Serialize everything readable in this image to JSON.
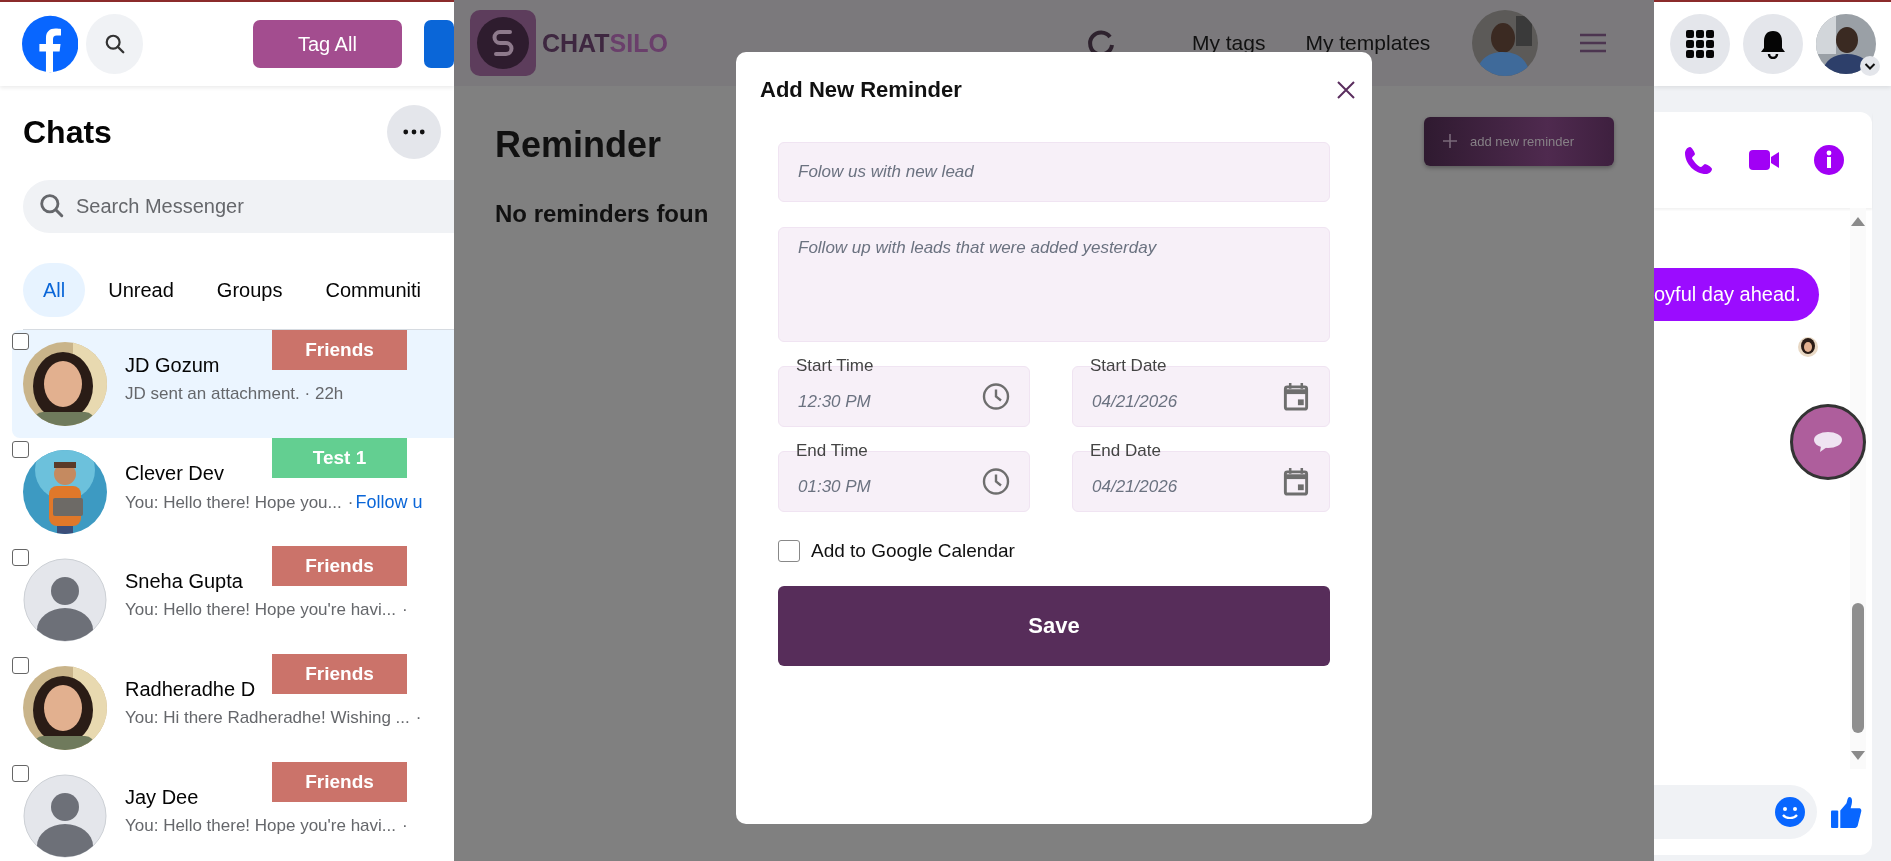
{
  "facebook": {
    "tag_all_button": "Tag All",
    "chats_title": "Chats",
    "search": {
      "placeholder": "Search Messenger"
    },
    "filters": [
      {
        "label": "All",
        "selected": true
      },
      {
        "label": "Unread",
        "selected": false
      },
      {
        "label": "Groups",
        "selected": false
      },
      {
        "label": "Communiti",
        "selected": false
      }
    ],
    "chats": [
      {
        "name": "JD Gozum",
        "message": "JD sent an attachment. · 22h",
        "selected": true,
        "checked": false,
        "tag": {
          "label": "Friends",
          "color": "#cb736a"
        }
      },
      {
        "name": "Clever Dev",
        "message": "You: Hello there! Hope you...",
        "meta": "·",
        "link": "Follow u",
        "selected": false,
        "checked": false,
        "tag": {
          "label": "Test 1",
          "color": "#63cf91"
        }
      },
      {
        "name": "Sneha Gupta",
        "message": "You: Hello there! Hope you're havi...",
        "meta": "·",
        "avatar": {
          "kind": "silhouette"
        },
        "selected": false,
        "checked": false,
        "tag": {
          "label": "Friends",
          "color": "#cb736a"
        }
      },
      {
        "name": "Radheradhe D",
        "message": "You: Hi there Radheradhe! Wishing ...",
        "meta": "·",
        "selected": false,
        "checked": false,
        "tag": {
          "label": "Friends",
          "color": "#cb736a"
        }
      },
      {
        "name": "Jay Dee",
        "message": "You: Hello there! Hope you're havi...",
        "meta": "·",
        "avatar": {
          "kind": "silhouette"
        },
        "selected": false,
        "checked": false,
        "tag": {
          "label": "Friends",
          "color": "#cb736a"
        }
      }
    ],
    "conversation": {
      "bubble": "oyful day ahead."
    }
  },
  "chatsilo": {
    "brand": [
      "CHAT",
      "SILO"
    ],
    "nav": [
      "My tags",
      "My templates"
    ],
    "page_title": "Reminder",
    "empty_message": "No reminders foun",
    "add_button": "add new reminder"
  },
  "dialog": {
    "title": "Add New Reminder",
    "title_field": {
      "placeholder": "Folow us with new lead"
    },
    "description_field": {
      "placeholder": "Follow up with leads that were added yesterday"
    },
    "schedule": [
      {
        "kind": "time",
        "label": "Start Time",
        "value": "12:30 PM"
      },
      {
        "kind": "date",
        "label": "Start Date",
        "value": "04/21/2026"
      },
      {
        "kind": "time",
        "label": "End Time",
        "value": "01:30 PM"
      },
      {
        "kind": "date",
        "label": "End Date",
        "value": "04/21/2026"
      }
    ],
    "google_calendar": {
      "label": "Add to Google Calendar",
      "checked": false
    },
    "save_button": "Save"
  }
}
